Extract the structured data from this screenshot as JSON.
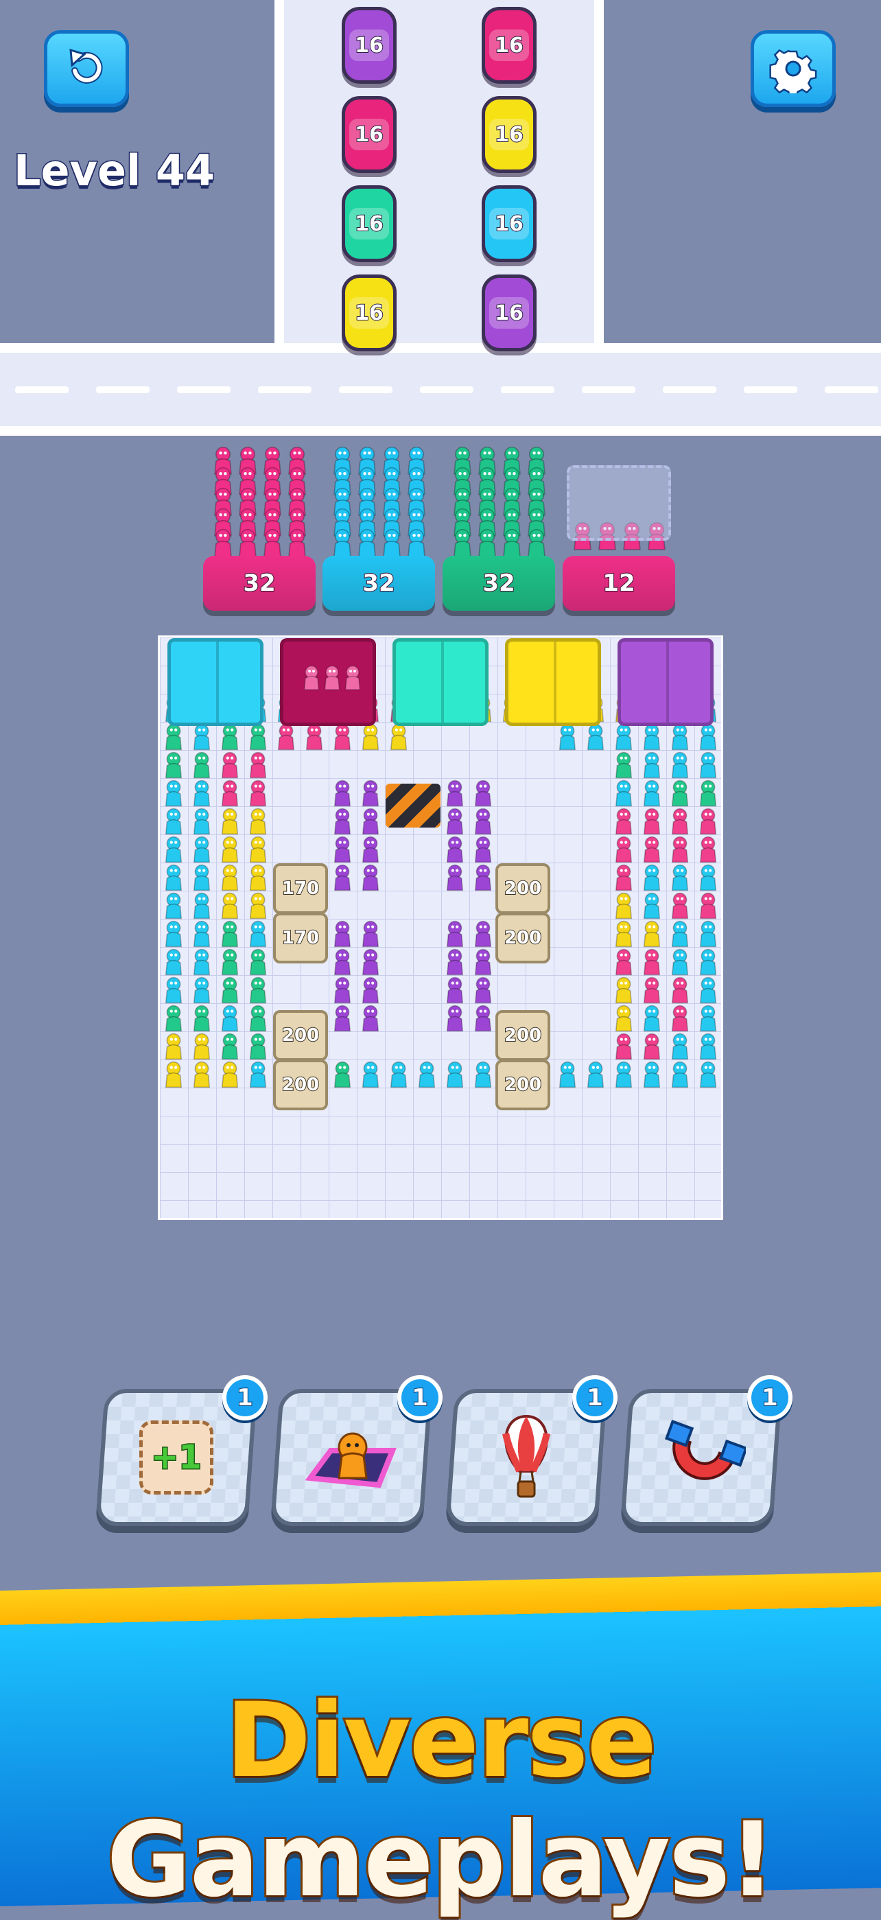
{
  "hud": {
    "level_label": "Level 44",
    "restart_icon": "restart-icon",
    "settings_icon": "gear-icon"
  },
  "cars": [
    {
      "capacity": "16",
      "color": "#a24bd6"
    },
    {
      "capacity": "16",
      "color": "#e8247c"
    },
    {
      "capacity": "16",
      "color": "#e8247c"
    },
    {
      "capacity": "16",
      "color": "#f6e114"
    },
    {
      "capacity": "16",
      "color": "#1fd6a3"
    },
    {
      "capacity": "16",
      "color": "#24c6f5"
    },
    {
      "capacity": "16",
      "color": "#f6e114"
    },
    {
      "capacity": "16",
      "color": "#a24bd6"
    }
  ],
  "queues": [
    {
      "count": "32",
      "color": "#ef2f88"
    },
    {
      "count": "32",
      "color": "#22c4f3"
    },
    {
      "count": "32",
      "color": "#1fc48a"
    },
    {
      "count": "12",
      "color": "#ef2f88"
    }
  ],
  "exits": [
    {
      "color": "#2fd3f6"
    },
    {
      "color": "#b0125a"
    },
    {
      "color": "#2fe9cd"
    },
    {
      "color": "#ffe21a"
    },
    {
      "color": "#a955d8"
    }
  ],
  "crates": [
    "170",
    "170",
    "200",
    "200",
    "200",
    "200",
    "200",
    "200"
  ],
  "boosters": [
    {
      "name": "add-slot",
      "icon": "plus-one-icon",
      "icon_text": "+1",
      "count": "1"
    },
    {
      "name": "teleport-pad",
      "icon": "character-pad-icon",
      "count": "1"
    },
    {
      "name": "balloon",
      "icon": "hot-air-balloon-icon",
      "count": "1"
    },
    {
      "name": "magnet",
      "icon": "magnet-icon",
      "count": "1"
    }
  ],
  "banner": {
    "word1": "Diverse",
    "word2": "Gameplays!"
  }
}
